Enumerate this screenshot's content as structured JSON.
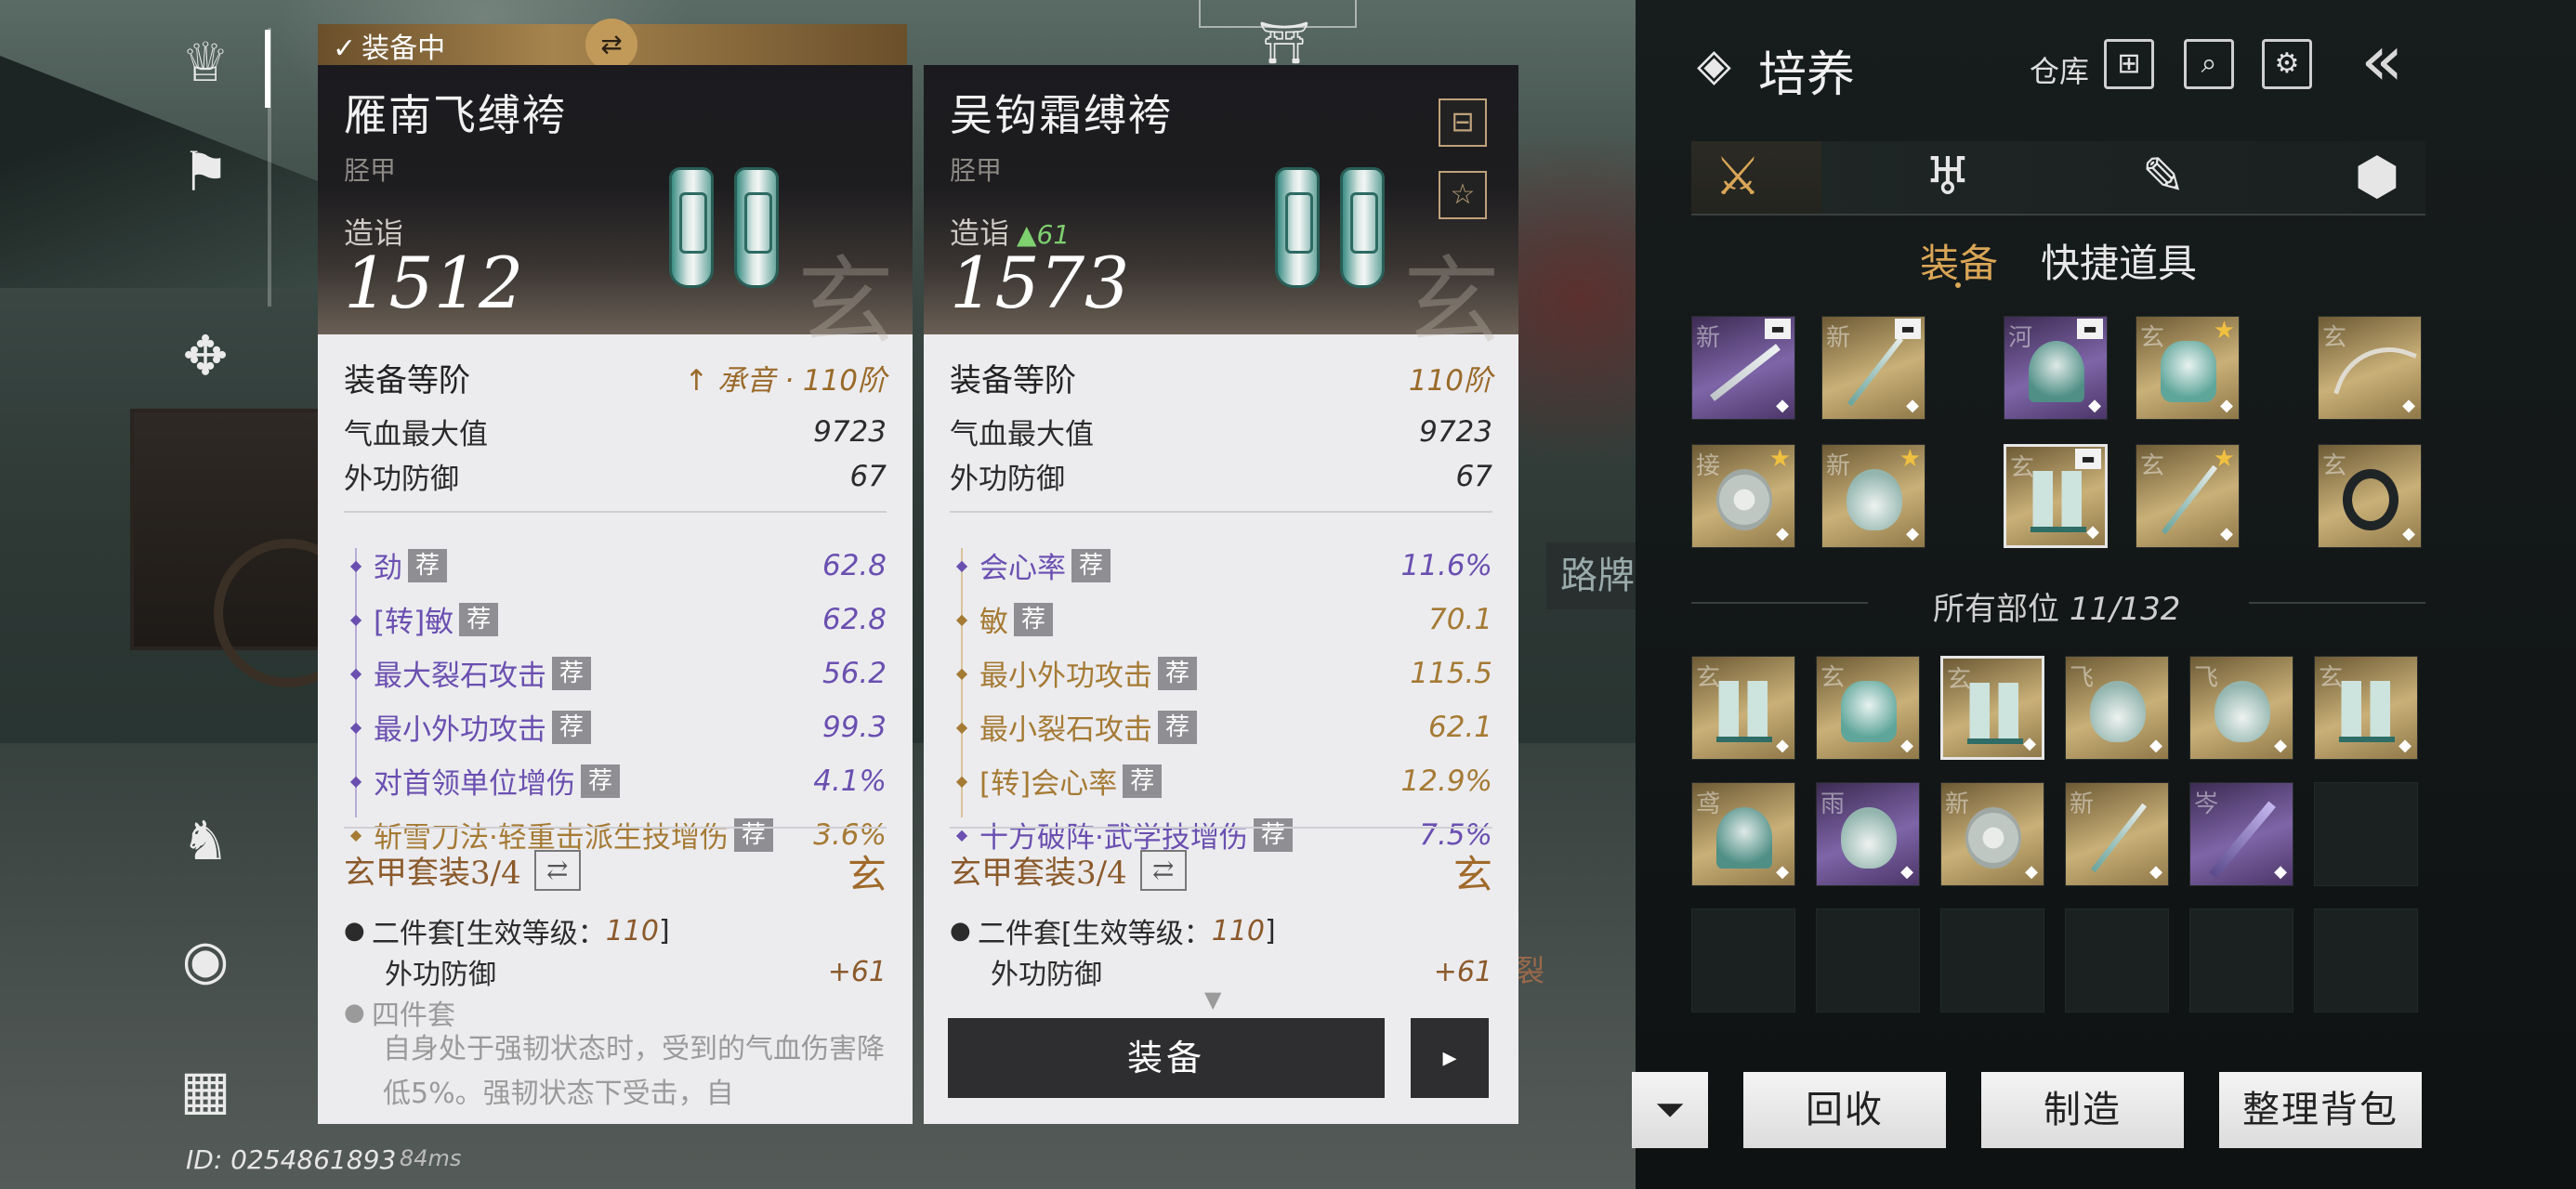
{
  "status": {
    "id_text": "ID: 0254861893",
    "ping": "84ms"
  },
  "left_card": {
    "equipped_label": "装备中",
    "title": "雁南飞缚袴",
    "type": "胫甲",
    "score_label": "造诣",
    "score": "1512",
    "watermark": "玄",
    "tier_label": "装备等阶",
    "tier_value": "↑ 承音 · 110阶",
    "base_stats": [
      {
        "name": "气血最大值",
        "value": "9723"
      },
      {
        "name": "外功防御",
        "value": "67"
      }
    ],
    "substats": [
      {
        "name": "劲",
        "tag": "荐",
        "value": "62.8",
        "color": "purple"
      },
      {
        "name": "[转]敏",
        "tag": "荐",
        "value": "62.8",
        "color": "purple"
      },
      {
        "name": "最大裂石攻击",
        "tag": "荐",
        "value": "56.2",
        "color": "purple"
      },
      {
        "name": "最小外功攻击",
        "tag": "荐",
        "value": "99.3",
        "color": "purple"
      },
      {
        "name": "对首领单位增伤",
        "tag": "荐",
        "value": "4.1%",
        "color": "purple"
      },
      {
        "name": "斩雪刀法·轻重击派生技增伤",
        "tag": "荐",
        "value": "3.6%",
        "color": "gold"
      }
    ],
    "set_title": "玄甲套装3/4",
    "set_icon": "玄",
    "set_two_prefix": "二件套[生效等级：",
    "set_two_level": "110",
    "set_two_suffix": "]",
    "set_two_stat": "外功防御",
    "set_two_bonus": "+61",
    "set_four": "四件套",
    "set_four_desc": "自身处于强韧状态时，受到的气血伤害降低5%。强韧状态下受击，自"
  },
  "right_card": {
    "title": "吴钩霜缚袴",
    "type": "胫甲",
    "score_label": "造诣",
    "score_delta": "▲61",
    "score": "1573",
    "watermark": "玄",
    "tier_label": "装备等阶",
    "tier_value": "110阶",
    "base_stats": [
      {
        "name": "气血最大值",
        "value": "9723"
      },
      {
        "name": "外功防御",
        "value": "67"
      }
    ],
    "substats": [
      {
        "name": "会心率",
        "tag": "荐",
        "value": "11.6%",
        "color": "purple"
      },
      {
        "name": "敏",
        "tag": "荐",
        "value": "70.1",
        "color": "gold"
      },
      {
        "name": "最小外功攻击",
        "tag": "荐",
        "value": "115.5",
        "color": "gold"
      },
      {
        "name": "最小裂石攻击",
        "tag": "荐",
        "value": "62.1",
        "color": "gold"
      },
      {
        "name": "[转]会心率",
        "tag": "荐",
        "value": "12.9%",
        "color": "gold"
      },
      {
        "name": "十方破阵·武学技增伤",
        "tag": "荐",
        "value": "7.5%",
        "color": "purple"
      }
    ],
    "set_title": "玄甲套装3/4",
    "set_icon": "玄",
    "set_two_prefix": "二件套[生效等级：",
    "set_two_level": "110",
    "set_two_suffix": "]",
    "set_two_stat": "外功防御",
    "set_two_bonus": "+61",
    "equip_button": "装备",
    "next_button": "▸"
  },
  "panel": {
    "title": "培养",
    "warehouse": "仓库",
    "tabs_sub": [
      "装备",
      "快捷道具"
    ],
    "count_label": "所有部位",
    "count_value": "11/132",
    "buttons": {
      "recycle": "回收",
      "craft": "制造",
      "sort": "整理背包"
    }
  },
  "equipped_slots": [
    {
      "ch": "新",
      "art": "sword",
      "bg": "purple",
      "badge": "lock"
    },
    {
      "ch": "新",
      "art": "spear",
      "bg": "gold",
      "badge": "lock"
    },
    {
      "ch": "河",
      "art": "helm",
      "bg": "purple",
      "badge": "lock"
    },
    {
      "ch": "玄",
      "art": "armor",
      "bg": "gold",
      "badge": "star"
    },
    {
      "ch": "玄",
      "art": "bow",
      "bg": "gold",
      "badge": "none"
    },
    {
      "ch": "接",
      "art": "disc",
      "bg": "gold",
      "badge": "star"
    },
    {
      "ch": "新",
      "art": "gourd",
      "bg": "gold",
      "badge": "star"
    },
    {
      "ch": "玄",
      "art": "leg2",
      "bg": "gold",
      "badge": "lock"
    },
    {
      "ch": "玄",
      "art": "spear",
      "bg": "gold",
      "badge": "star"
    },
    {
      "ch": "玄",
      "art": "ring",
      "bg": "gold",
      "badge": "none"
    }
  ],
  "inventory": [
    {
      "ch": "玄",
      "art": "leg2",
      "bg": "gold"
    },
    {
      "ch": "玄",
      "art": "armor",
      "bg": "gold"
    },
    {
      "ch": "玄",
      "art": "leg2",
      "bg": "gold"
    },
    {
      "ch": "飞",
      "art": "gourd",
      "bg": "gold"
    },
    {
      "ch": "飞",
      "art": "gourd",
      "bg": "gold"
    },
    {
      "ch": "玄",
      "art": "leg2",
      "bg": "gold"
    },
    {
      "ch": "鸢",
      "art": "helm",
      "bg": "gold"
    },
    {
      "ch": "雨",
      "art": "gourd",
      "bg": "purple"
    },
    {
      "ch": "新",
      "art": "disc",
      "bg": "gold"
    },
    {
      "ch": "新",
      "art": "spear",
      "bg": "gold"
    },
    {
      "ch": "岑",
      "art": "blade",
      "bg": "purple"
    }
  ],
  "background": {
    "sign": "路牌",
    "glyph": "裂"
  },
  "colors": {
    "gold": "#d9a657",
    "purple_text": "#6a4fb0",
    "gold_text": "#a57a34"
  }
}
